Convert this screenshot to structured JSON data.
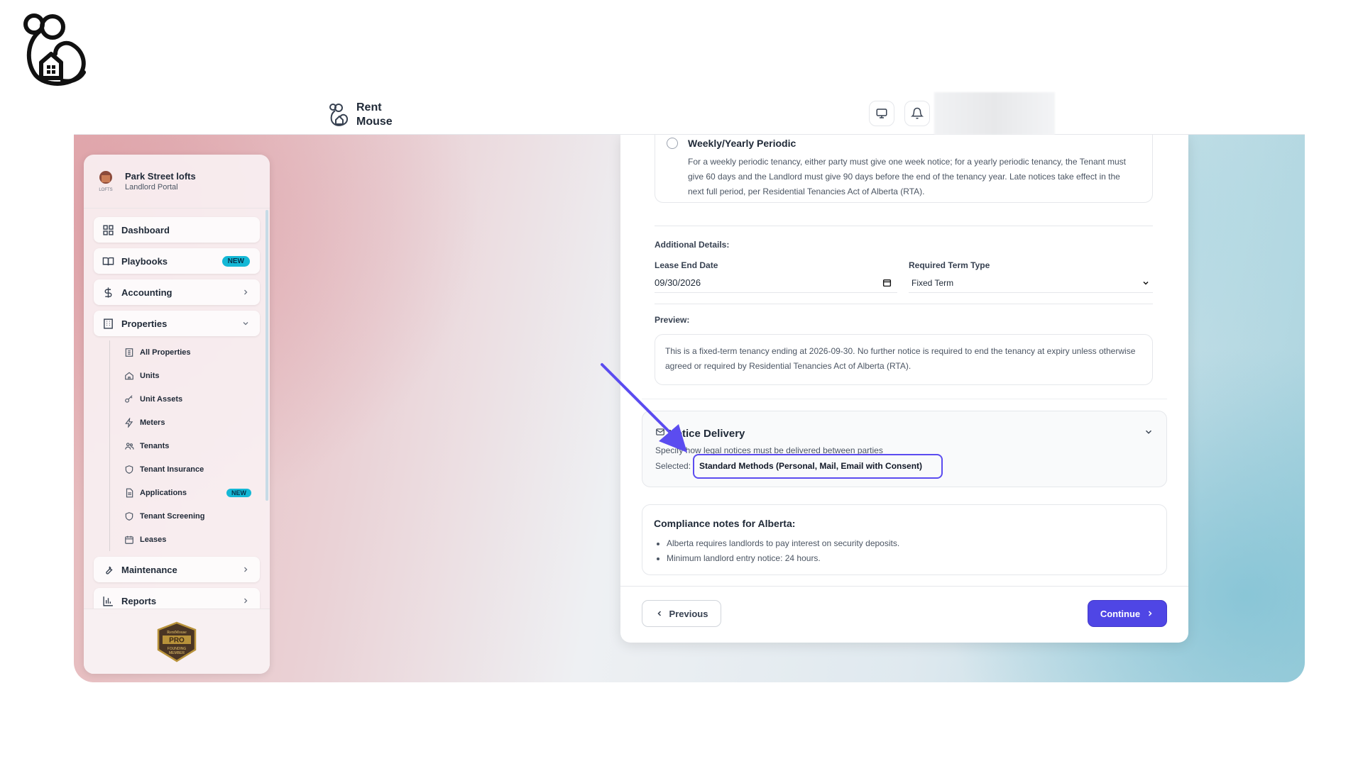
{
  "app": {
    "name_line1": "Rent",
    "name_line2": "Mouse"
  },
  "sidebar": {
    "org_name": "Park Street lofts",
    "org_subtitle": "Landlord Portal",
    "items": [
      {
        "label": "Dashboard"
      },
      {
        "label": "Playbooks",
        "badge": "NEW"
      },
      {
        "label": "Accounting"
      },
      {
        "label": "Properties"
      },
      {
        "label": "Maintenance"
      },
      {
        "label": "Reports"
      }
    ],
    "properties_sub": [
      {
        "label": "All Properties"
      },
      {
        "label": "Units"
      },
      {
        "label": "Unit Assets"
      },
      {
        "label": "Meters"
      },
      {
        "label": "Tenants"
      },
      {
        "label": "Tenant Insurance"
      },
      {
        "label": "Applications",
        "badge": "NEW"
      },
      {
        "label": "Tenant Screening"
      },
      {
        "label": "Leases"
      }
    ],
    "footer_badge": {
      "line1": "RentMouse",
      "line2": "PRO",
      "line3": "FOUNDING",
      "line4": "MEMBER"
    }
  },
  "form": {
    "periodic_option": {
      "title": "Weekly/Yearly Periodic",
      "description": "For a weekly periodic tenancy, either party must give one week notice; for a yearly periodic tenancy, the Tenant must give 60 days and the Landlord must give 90 days before the end of the tenancy year. Late notices take effect in the next full period, per Residential Tenancies Act of Alberta (RTA)."
    },
    "additional_details_label": "Additional Details:",
    "lease_end_date_label": "Lease End Date",
    "lease_end_date_value": "09/30/2026",
    "required_term_type_label": "Required Term Type",
    "required_term_type_value": "Fixed Term",
    "preview_label": "Preview:",
    "preview_text": "This is a fixed-term tenancy ending at 2026-09-30. No further notice is required to end the tenancy at expiry unless otherwise agreed or required by Residential Tenancies Act of Alberta (RTA).",
    "notice_delivery": {
      "title": "Notice Delivery",
      "description": "Specify how legal notices must be delivered between parties",
      "selected_label": "Selected:",
      "selected_value": "Standard Methods (Personal, Mail, Email with Consent)"
    },
    "compliance": {
      "title": "Compliance notes for Alberta:",
      "notes": [
        "Alberta requires landlords to pay interest on security deposits.",
        "Minimum landlord entry notice: 24 hours."
      ]
    },
    "previous_label": "Previous",
    "continue_label": "Continue"
  },
  "colors": {
    "accent": "#4f46e5",
    "highlight": "#5b4cf0",
    "badge": "#14b8d6"
  }
}
